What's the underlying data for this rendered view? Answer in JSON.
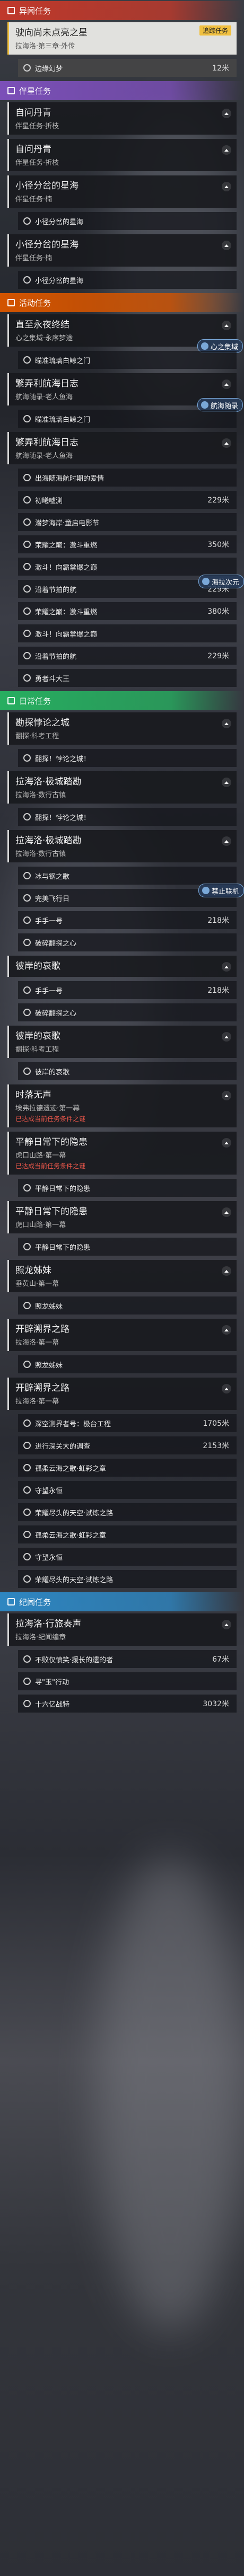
{
  "sections": [
    {
      "title": "异闻任务",
      "color": "#c0392b",
      "items": [
        {
          "type": "card",
          "title": "驶向尚未点亮之星",
          "sub": "拉海洛·第三章·外传",
          "selected": true,
          "badge": "追踪任务"
        },
        {
          "type": "obj",
          "text": "边缘幻梦",
          "dist": "12米",
          "hl": true
        }
      ]
    },
    {
      "title": "伴星任务",
      "color": "#7b4fb8",
      "items": [
        {
          "type": "card",
          "title": "自问丹青",
          "sub": "伴星任务·折枝"
        },
        {
          "type": "card",
          "title": "自问丹青",
          "sub": "伴星任务·折枝"
        },
        {
          "type": "card",
          "title": "小径分岔的星海",
          "sub": "伴星任务·楠"
        },
        {
          "type": "obj",
          "text": "小径分岔的星海"
        },
        {
          "type": "card",
          "title": "小径分岔的星海",
          "sub": "伴星任务·楠"
        },
        {
          "type": "obj",
          "text": "小径分岔的星海"
        }
      ]
    },
    {
      "title": "活动任务",
      "color": "#d35400",
      "items": [
        {
          "type": "card",
          "title": "直至永夜终结",
          "sub": "心之集域·永序梦途",
          "tag": "心之集域"
        },
        {
          "type": "obj",
          "text": "瞄准琉璃白鲸之门"
        },
        {
          "type": "card",
          "title": "繁弄利航海日志",
          "sub": "航海随录·老人鱼海",
          "tag": "航海随录"
        },
        {
          "type": "obj",
          "text": "瞄准琉璃白鲸之门"
        },
        {
          "type": "card",
          "title": "繁弄利航海日志",
          "sub": "航海随录·老人鱼海"
        },
        {
          "type": "obj",
          "text": "出海随海航时期的爱情"
        },
        {
          "type": "obj",
          "text": "初曦嘘測",
          "dist": "229米"
        },
        {
          "type": "obj",
          "text": "潜梦海岸·童启电影节"
        },
        {
          "type": "obj",
          "text": "荣耀之巅：激斗重燃",
          "dist": "350米"
        },
        {
          "type": "obj",
          "text": "激斗！向霸掌爆之巅"
        },
        {
          "type": "obj",
          "text": "沿着节拍的航",
          "dist": "229米",
          "tag": "海拉次元"
        },
        {
          "type": "obj",
          "text": "荣耀之巅：激斗重燃",
          "dist": "380米"
        },
        {
          "type": "obj",
          "text": "激斗！向霸掌爆之巅"
        },
        {
          "type": "obj",
          "text": "沿着节拍的航",
          "dist": "229米"
        },
        {
          "type": "obj",
          "text": "勇者斗大王"
        }
      ]
    },
    {
      "title": "日常任务",
      "color": "#27ae60",
      "items": [
        {
          "type": "card",
          "title": "勘探悖论之城",
          "sub": "翻探·科考工程"
        },
        {
          "type": "obj",
          "text": "翻探！悖论之城！"
        },
        {
          "type": "card",
          "title": "拉海洛·极城踏勘",
          "sub": "拉海洛·数行古镇"
        },
        {
          "type": "obj",
          "text": "翻探！悖论之城！"
        },
        {
          "type": "card",
          "title": "拉海洛·极城踏勘",
          "sub": "拉海洛·数行古镇"
        },
        {
          "type": "obj",
          "text": "冰与钢之歌"
        },
        {
          "type": "obj",
          "text": "完美飞行日",
          "tag": "禁止联机"
        },
        {
          "type": "obj",
          "text": "手手一号",
          "dist": "218米"
        },
        {
          "type": "obj",
          "text": "破碎翻探之心"
        },
        {
          "type": "card",
          "title": "彼岸的哀歌",
          "sub": ""
        },
        {
          "type": "obj",
          "text": "手手一号",
          "dist": "218米"
        },
        {
          "type": "obj",
          "text": "破碎翻探之心"
        },
        {
          "type": "card",
          "title": "彼岸的哀歌",
          "sub": "翻探·科考工程"
        },
        {
          "type": "obj",
          "text": "彼岸的哀歌"
        },
        {
          "type": "card",
          "title": "时落无声",
          "sub": "埃弗拉德遗迹·第一幕",
          "warn": "已达成当前任务条件之谜"
        },
        {
          "type": "card",
          "title": "平静日常下的隐患",
          "sub": "虎口山路·第一幕",
          "warn": "已达成当前任务条件之谜"
        },
        {
          "type": "obj",
          "text": "平静日常下的隐患"
        },
        {
          "type": "card",
          "title": "平静日常下的隐患",
          "sub": "虎口山路·第一幕"
        },
        {
          "type": "obj",
          "text": "平静日常下的隐患"
        },
        {
          "type": "card",
          "title": "照龙姊妹",
          "sub": "垂黄山·第一幕"
        },
        {
          "type": "obj",
          "text": "照龙姊妹"
        },
        {
          "type": "card",
          "title": "开辟溯界之路",
          "sub": "拉海洛·第一幕"
        },
        {
          "type": "obj",
          "text": "照龙姊妹"
        },
        {
          "type": "card",
          "title": "开辟溯界之路",
          "sub": "拉海洛·第一幕"
        },
        {
          "type": "obj",
          "text": "深空测界者号：极台工程",
          "dist": "1705米"
        },
        {
          "type": "obj",
          "text": "进行深关大的调查",
          "dist": "2153米"
        },
        {
          "type": "obj",
          "text": "孤柔云海之歌·虹彩之章"
        },
        {
          "type": "obj",
          "text": "守望永恒"
        },
        {
          "type": "obj",
          "text": "荣耀尽头的天空·试炼之路"
        },
        {
          "type": "obj",
          "text": "孤柔云海之歌·虹彩之章"
        },
        {
          "type": "obj",
          "text": "守望永恒"
        },
        {
          "type": "obj",
          "text": "荣耀尽头的天空·试炼之路"
        }
      ]
    },
    {
      "title": "纪闻任务",
      "color": "#2e86c1",
      "items": [
        {
          "type": "card",
          "title": "拉海洛·行旅奏声",
          "sub": "拉海洛·纪闻编章"
        },
        {
          "type": "obj",
          "text": "不败仅愤笑·援长的遗的者",
          "dist": "67米"
        },
        {
          "type": "obj",
          "text": "寻\"玉\"行动"
        },
        {
          "type": "obj",
          "text": "十六亿战特",
          "dist": "3032米"
        }
      ]
    }
  ]
}
